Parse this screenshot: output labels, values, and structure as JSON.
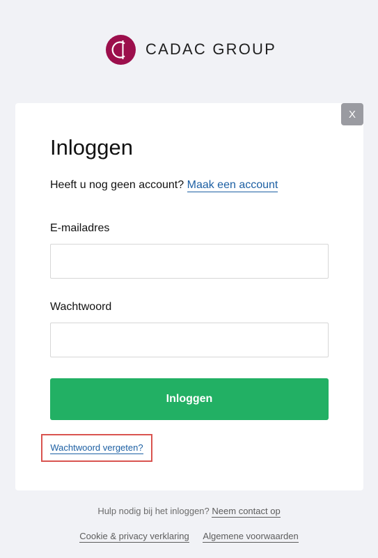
{
  "brand": {
    "name": "CADAC GROUP",
    "logo_icon": "cadac-logo-icon",
    "logo_color": "#9c0f4c"
  },
  "modal": {
    "close_label": "X",
    "title": "Inloggen",
    "signup_prompt": "Heeft u nog geen account?",
    "signup_link": "Maak een account",
    "email": {
      "label": "E-mailadres",
      "value": "",
      "placeholder": ""
    },
    "password": {
      "label": "Wachtwoord",
      "value": "",
      "placeholder": ""
    },
    "submit_label": "Inloggen",
    "forgot_link": "Wachtwoord vergeten?"
  },
  "footer": {
    "help_text": "Hulp nodig bij het inloggen?",
    "help_link": "Neem contact op",
    "cookie_link": "Cookie & privacy verklaring",
    "terms_link": "Algemene voorwaarden"
  },
  "colors": {
    "background": "#f1f2f6",
    "primary_button": "#22b064",
    "link": "#1c5fa3",
    "highlight_border": "#d9534f",
    "close_button": "#9a9ba1"
  }
}
